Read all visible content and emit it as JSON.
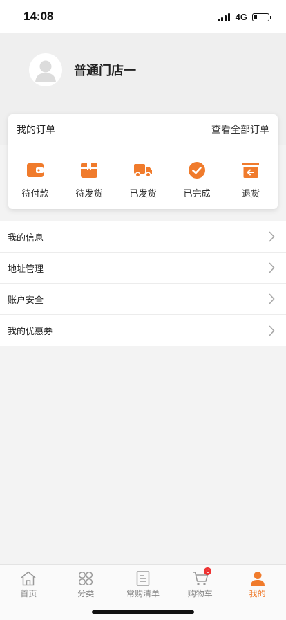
{
  "status_bar": {
    "time": "14:08",
    "network": "4G",
    "battery_level": 0.2
  },
  "profile": {
    "store_name": "普通门店一"
  },
  "orders": {
    "title": "我的订单",
    "view_all": "查看全部订单",
    "items": [
      {
        "label": "待付款",
        "icon": "wallet-icon"
      },
      {
        "label": "待发货",
        "icon": "package-icon"
      },
      {
        "label": "已发货",
        "icon": "truck-icon"
      },
      {
        "label": "已完成",
        "icon": "check-circle-icon"
      },
      {
        "label": "退货",
        "icon": "return-icon"
      }
    ]
  },
  "menu": {
    "items": [
      {
        "label": "我的信息"
      },
      {
        "label": "地址管理"
      },
      {
        "label": "账户安全"
      },
      {
        "label": "我的优惠券"
      }
    ]
  },
  "tabbar": {
    "items": [
      {
        "label": "首页",
        "icon": "home-icon"
      },
      {
        "label": "分类",
        "icon": "category-icon"
      },
      {
        "label": "常购清单",
        "icon": "list-icon"
      },
      {
        "label": "购物车",
        "icon": "cart-icon",
        "badge": "0"
      },
      {
        "label": "我的",
        "icon": "user-icon",
        "active": true
      }
    ]
  },
  "colors": {
    "accent": "#f07b2c",
    "badge": "#e33333",
    "background": "#f3f3f3"
  }
}
